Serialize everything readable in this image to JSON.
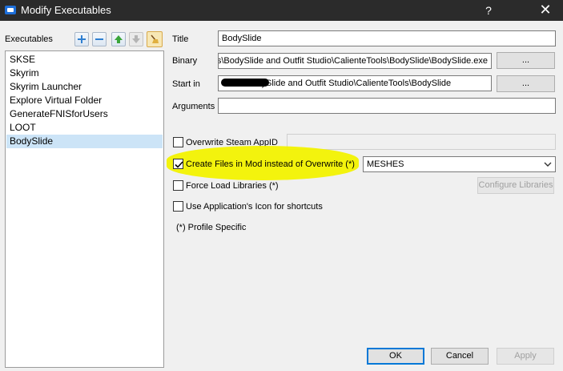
{
  "window": {
    "title": "Modify Executables",
    "help_glyph": "?",
    "close_glyph": "✕"
  },
  "left": {
    "heading": "Executables",
    "toolbar": [
      "add-icon",
      "remove-icon",
      "move-up-icon",
      "move-down-icon",
      "clear-icon"
    ],
    "items": [
      "SKSE",
      "Skyrim",
      "Skyrim Launcher",
      "Explore Virtual Folder",
      "GenerateFNISforUsers",
      "LOOT",
      "BodySlide"
    ],
    "selected_index": 6
  },
  "form": {
    "title_label": "Title",
    "title_value": "BodySlide",
    "binary_label": "Binary",
    "binary_value": "ds\\BodySlide and Outfit Studio\\CalienteTools\\BodySlide\\BodySlide.exe",
    "binary_browse": "...",
    "startin_label": "Start in",
    "startin_value": "mods\\BodySlide and Outfit Studio\\CalienteTools\\BodySlide",
    "startin_browse": "...",
    "arguments_label": "Arguments",
    "arguments_value": ""
  },
  "options": {
    "steam_appid_label": "Overwrite Steam AppID",
    "steam_appid_checked": false,
    "steam_appid_value": "",
    "create_files_label": "Create Files in Mod instead of Overwrite (*)",
    "create_files_checked": true,
    "create_files_mod": "MESHES",
    "force_load_label": "Force Load Libraries (*)",
    "force_load_checked": false,
    "configure_libraries": "Configure Libraries",
    "app_icon_label": "Use Application's Icon for shortcuts",
    "app_icon_checked": false,
    "profile_note": "(*) Profile Specific"
  },
  "buttons": {
    "ok": "OK",
    "cancel": "Cancel",
    "apply": "Apply"
  },
  "colors": {
    "titlebar": "#2b2b2b",
    "selection": "#cce4f7",
    "highlight": "#f2f200",
    "default_button_border": "#0078d7"
  }
}
